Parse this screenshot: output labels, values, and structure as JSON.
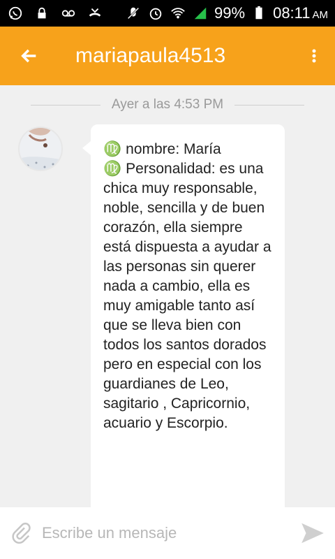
{
  "status_bar": {
    "battery": "99%",
    "time": "08:11",
    "ampm": "AM"
  },
  "app_bar": {
    "title": "mariapaula4513"
  },
  "chat": {
    "timestamp": "Ayer a las 4:53 PM",
    "message": {
      "zodiac_symbol": "♍",
      "line1": "nombre: María",
      "line2": "Personalidad: es una chica muy responsable, noble, sencilla y de buen corazón, ella siempre está dispuesta a ayudar a las personas sin querer nada a cambio, ella es muy amigable tanto así que se lleva bien con todos los santos dorados pero en especial con los guardianes de Leo, sagitario , Capricornio, acuario y Escorpio."
    }
  },
  "composer": {
    "placeholder": "Escribe un mensaje"
  },
  "colors": {
    "accent": "#f7a21b",
    "zodiac": "#f2a91e",
    "status_bar": "#000000",
    "signal_green": "#27c04a"
  },
  "icons": [
    "whatsapp-icon",
    "lock-icon",
    "voicemail-icon",
    "missed-call-icon",
    "mute-icon",
    "alarm-icon",
    "wifi-icon",
    "signal-icon",
    "battery-icon",
    "back-arrow-icon",
    "more-vert-icon",
    "paperclip-icon",
    "send-icon"
  ]
}
